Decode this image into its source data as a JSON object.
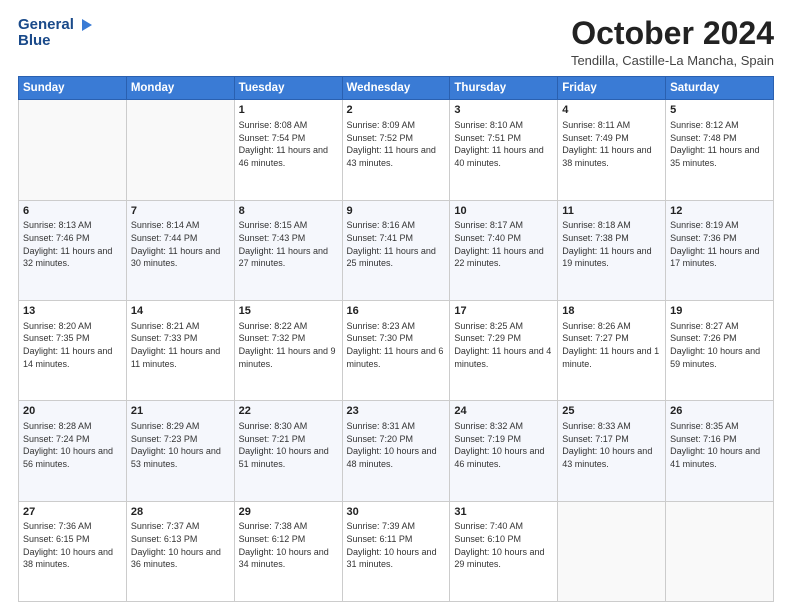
{
  "header": {
    "logo_line1": "General",
    "logo_line2": "Blue",
    "month_title": "October 2024",
    "subtitle": "Tendilla, Castille-La Mancha, Spain"
  },
  "weekdays": [
    "Sunday",
    "Monday",
    "Tuesday",
    "Wednesday",
    "Thursday",
    "Friday",
    "Saturday"
  ],
  "weeks": [
    [
      {
        "day": "",
        "info": ""
      },
      {
        "day": "",
        "info": ""
      },
      {
        "day": "1",
        "info": "Sunrise: 8:08 AM\nSunset: 7:54 PM\nDaylight: 11 hours and 46 minutes."
      },
      {
        "day": "2",
        "info": "Sunrise: 8:09 AM\nSunset: 7:52 PM\nDaylight: 11 hours and 43 minutes."
      },
      {
        "day": "3",
        "info": "Sunrise: 8:10 AM\nSunset: 7:51 PM\nDaylight: 11 hours and 40 minutes."
      },
      {
        "day": "4",
        "info": "Sunrise: 8:11 AM\nSunset: 7:49 PM\nDaylight: 11 hours and 38 minutes."
      },
      {
        "day": "5",
        "info": "Sunrise: 8:12 AM\nSunset: 7:48 PM\nDaylight: 11 hours and 35 minutes."
      }
    ],
    [
      {
        "day": "6",
        "info": "Sunrise: 8:13 AM\nSunset: 7:46 PM\nDaylight: 11 hours and 32 minutes."
      },
      {
        "day": "7",
        "info": "Sunrise: 8:14 AM\nSunset: 7:44 PM\nDaylight: 11 hours and 30 minutes."
      },
      {
        "day": "8",
        "info": "Sunrise: 8:15 AM\nSunset: 7:43 PM\nDaylight: 11 hours and 27 minutes."
      },
      {
        "day": "9",
        "info": "Sunrise: 8:16 AM\nSunset: 7:41 PM\nDaylight: 11 hours and 25 minutes."
      },
      {
        "day": "10",
        "info": "Sunrise: 8:17 AM\nSunset: 7:40 PM\nDaylight: 11 hours and 22 minutes."
      },
      {
        "day": "11",
        "info": "Sunrise: 8:18 AM\nSunset: 7:38 PM\nDaylight: 11 hours and 19 minutes."
      },
      {
        "day": "12",
        "info": "Sunrise: 8:19 AM\nSunset: 7:36 PM\nDaylight: 11 hours and 17 minutes."
      }
    ],
    [
      {
        "day": "13",
        "info": "Sunrise: 8:20 AM\nSunset: 7:35 PM\nDaylight: 11 hours and 14 minutes."
      },
      {
        "day": "14",
        "info": "Sunrise: 8:21 AM\nSunset: 7:33 PM\nDaylight: 11 hours and 11 minutes."
      },
      {
        "day": "15",
        "info": "Sunrise: 8:22 AM\nSunset: 7:32 PM\nDaylight: 11 hours and 9 minutes."
      },
      {
        "day": "16",
        "info": "Sunrise: 8:23 AM\nSunset: 7:30 PM\nDaylight: 11 hours and 6 minutes."
      },
      {
        "day": "17",
        "info": "Sunrise: 8:25 AM\nSunset: 7:29 PM\nDaylight: 11 hours and 4 minutes."
      },
      {
        "day": "18",
        "info": "Sunrise: 8:26 AM\nSunset: 7:27 PM\nDaylight: 11 hours and 1 minute."
      },
      {
        "day": "19",
        "info": "Sunrise: 8:27 AM\nSunset: 7:26 PM\nDaylight: 10 hours and 59 minutes."
      }
    ],
    [
      {
        "day": "20",
        "info": "Sunrise: 8:28 AM\nSunset: 7:24 PM\nDaylight: 10 hours and 56 minutes."
      },
      {
        "day": "21",
        "info": "Sunrise: 8:29 AM\nSunset: 7:23 PM\nDaylight: 10 hours and 53 minutes."
      },
      {
        "day": "22",
        "info": "Sunrise: 8:30 AM\nSunset: 7:21 PM\nDaylight: 10 hours and 51 minutes."
      },
      {
        "day": "23",
        "info": "Sunrise: 8:31 AM\nSunset: 7:20 PM\nDaylight: 10 hours and 48 minutes."
      },
      {
        "day": "24",
        "info": "Sunrise: 8:32 AM\nSunset: 7:19 PM\nDaylight: 10 hours and 46 minutes."
      },
      {
        "day": "25",
        "info": "Sunrise: 8:33 AM\nSunset: 7:17 PM\nDaylight: 10 hours and 43 minutes."
      },
      {
        "day": "26",
        "info": "Sunrise: 8:35 AM\nSunset: 7:16 PM\nDaylight: 10 hours and 41 minutes."
      }
    ],
    [
      {
        "day": "27",
        "info": "Sunrise: 7:36 AM\nSunset: 6:15 PM\nDaylight: 10 hours and 38 minutes."
      },
      {
        "day": "28",
        "info": "Sunrise: 7:37 AM\nSunset: 6:13 PM\nDaylight: 10 hours and 36 minutes."
      },
      {
        "day": "29",
        "info": "Sunrise: 7:38 AM\nSunset: 6:12 PM\nDaylight: 10 hours and 34 minutes."
      },
      {
        "day": "30",
        "info": "Sunrise: 7:39 AM\nSunset: 6:11 PM\nDaylight: 10 hours and 31 minutes."
      },
      {
        "day": "31",
        "info": "Sunrise: 7:40 AM\nSunset: 6:10 PM\nDaylight: 10 hours and 29 minutes."
      },
      {
        "day": "",
        "info": ""
      },
      {
        "day": "",
        "info": ""
      }
    ]
  ]
}
